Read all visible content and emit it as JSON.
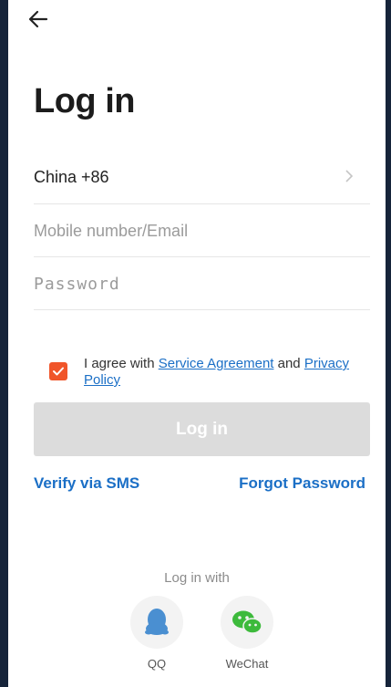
{
  "header": {
    "back_icon": "arrow-left-icon"
  },
  "title": "Log in",
  "country": {
    "label": "China +86",
    "chevron_icon": "chevron-right-icon"
  },
  "mobile": {
    "placeholder": "Mobile number/Email",
    "value": ""
  },
  "password": {
    "placeholder": "Password",
    "value": ""
  },
  "agreement": {
    "checked": true,
    "prefix": "I agree with ",
    "link1": "Service Agreement",
    "middle": " and ",
    "link2": "Privacy Policy"
  },
  "login_button": "Log in",
  "links": {
    "sms": "Verify via SMS",
    "forgot": "Forgot Password"
  },
  "social": {
    "heading": "Log in with",
    "items": [
      {
        "label": "QQ",
        "icon": "qq-icon"
      },
      {
        "label": "WeChat",
        "icon": "wechat-icon"
      }
    ]
  },
  "colors": {
    "accent": "#1b6fc6",
    "checkbox": "#f0552a",
    "button_disabled": "#dcdcdc"
  }
}
